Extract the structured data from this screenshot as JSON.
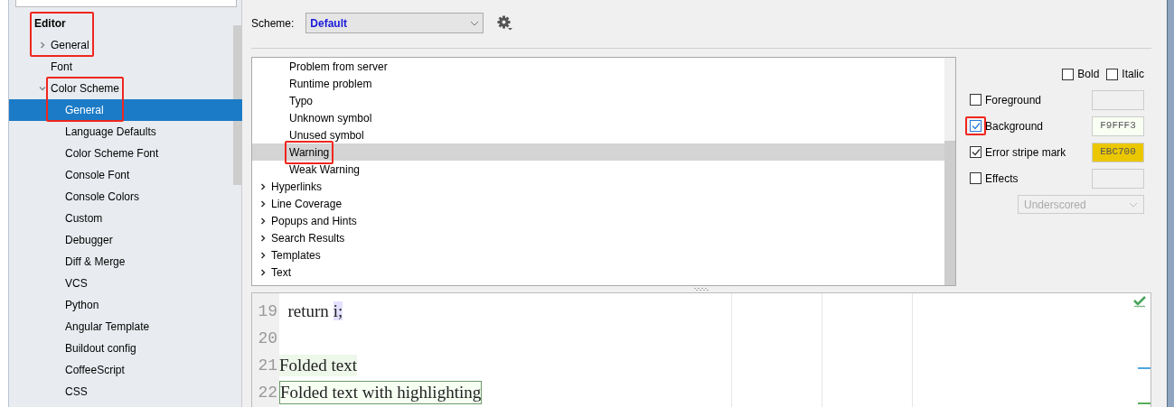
{
  "sidebar": {
    "items": [
      {
        "label": "Editor",
        "kind": "category",
        "annotated": true,
        "children": [
          {
            "label": "General",
            "expanded": false,
            "selected": false,
            "annotated": true
          },
          {
            "label": "Font",
            "selected": false
          },
          {
            "label": "Color Scheme",
            "expanded": true,
            "selected": false,
            "annotated": true,
            "children": [
              {
                "label": "General",
                "selected": true,
                "annotated": true
              },
              {
                "label": "Language Defaults",
                "selected": false
              },
              {
                "label": "Color Scheme Font",
                "selected": false
              },
              {
                "label": "Console Font",
                "selected": false
              },
              {
                "label": "Console Colors",
                "selected": false
              },
              {
                "label": "Custom",
                "selected": false
              },
              {
                "label": "Debugger",
                "selected": false
              },
              {
                "label": "Diff & Merge",
                "selected": false
              },
              {
                "label": "VCS",
                "selected": false
              },
              {
                "label": "Python",
                "selected": false
              },
              {
                "label": "Angular Template",
                "selected": false
              },
              {
                "label": "Buildout config",
                "selected": false
              },
              {
                "label": "CoffeeScript",
                "selected": false
              },
              {
                "label": "CSS",
                "selected": false
              }
            ]
          }
        ]
      }
    ]
  },
  "scheme": {
    "label": "Scheme:",
    "value": "Default"
  },
  "tree": {
    "rows": [
      {
        "label": "Problem from server",
        "selected": false
      },
      {
        "label": "Runtime problem",
        "selected": false
      },
      {
        "label": "Typo",
        "selected": false
      },
      {
        "label": "Unknown symbol",
        "selected": false
      },
      {
        "label": "Unused symbol",
        "selected": false
      },
      {
        "label": "Warning",
        "selected": true,
        "annotated": true
      },
      {
        "label": "Weak Warning",
        "selected": false
      }
    ],
    "groups": [
      {
        "label": "Hyperlinks",
        "expanded": false
      },
      {
        "label": "Line Coverage",
        "expanded": false
      },
      {
        "label": "Popups and Hints",
        "expanded": false
      },
      {
        "label": "Search Results",
        "expanded": false
      },
      {
        "label": "Templates",
        "expanded": false
      },
      {
        "label": "Text",
        "expanded": false
      }
    ]
  },
  "options": {
    "font_style": [
      {
        "label": "Bold",
        "checked": false
      },
      {
        "label": "Italic",
        "checked": false
      }
    ],
    "attributes": [
      {
        "label": "Foreground",
        "checked": false
      },
      {
        "label": "Background",
        "checked": true,
        "value": "F9FFF3",
        "color": "#f9fff3",
        "annotated": true
      },
      {
        "label": "Error stripe mark",
        "checked": true,
        "value": "EBC700",
        "color": "#ebc700"
      },
      {
        "label": "Effects",
        "checked": false
      }
    ],
    "effect_type": {
      "value": "Underscored",
      "disabled": true
    }
  },
  "preview": {
    "lines": [
      {
        "number": "19",
        "kind": "plain",
        "segments": [
          {
            "text": "  return ",
            "kind": "plain"
          },
          {
            "text": "i;",
            "kind": "usage"
          }
        ]
      },
      {
        "number": "20",
        "kind": "plain"
      },
      {
        "number": "21",
        "kind": "folded",
        "segments": [
          {
            "text": "Folded text",
            "kind": "plain"
          }
        ]
      },
      {
        "number": "22",
        "kind": "folded-highlighted",
        "segments": [
          {
            "text": "Folded text with highlighting",
            "kind": "plain"
          }
        ]
      }
    ]
  }
}
